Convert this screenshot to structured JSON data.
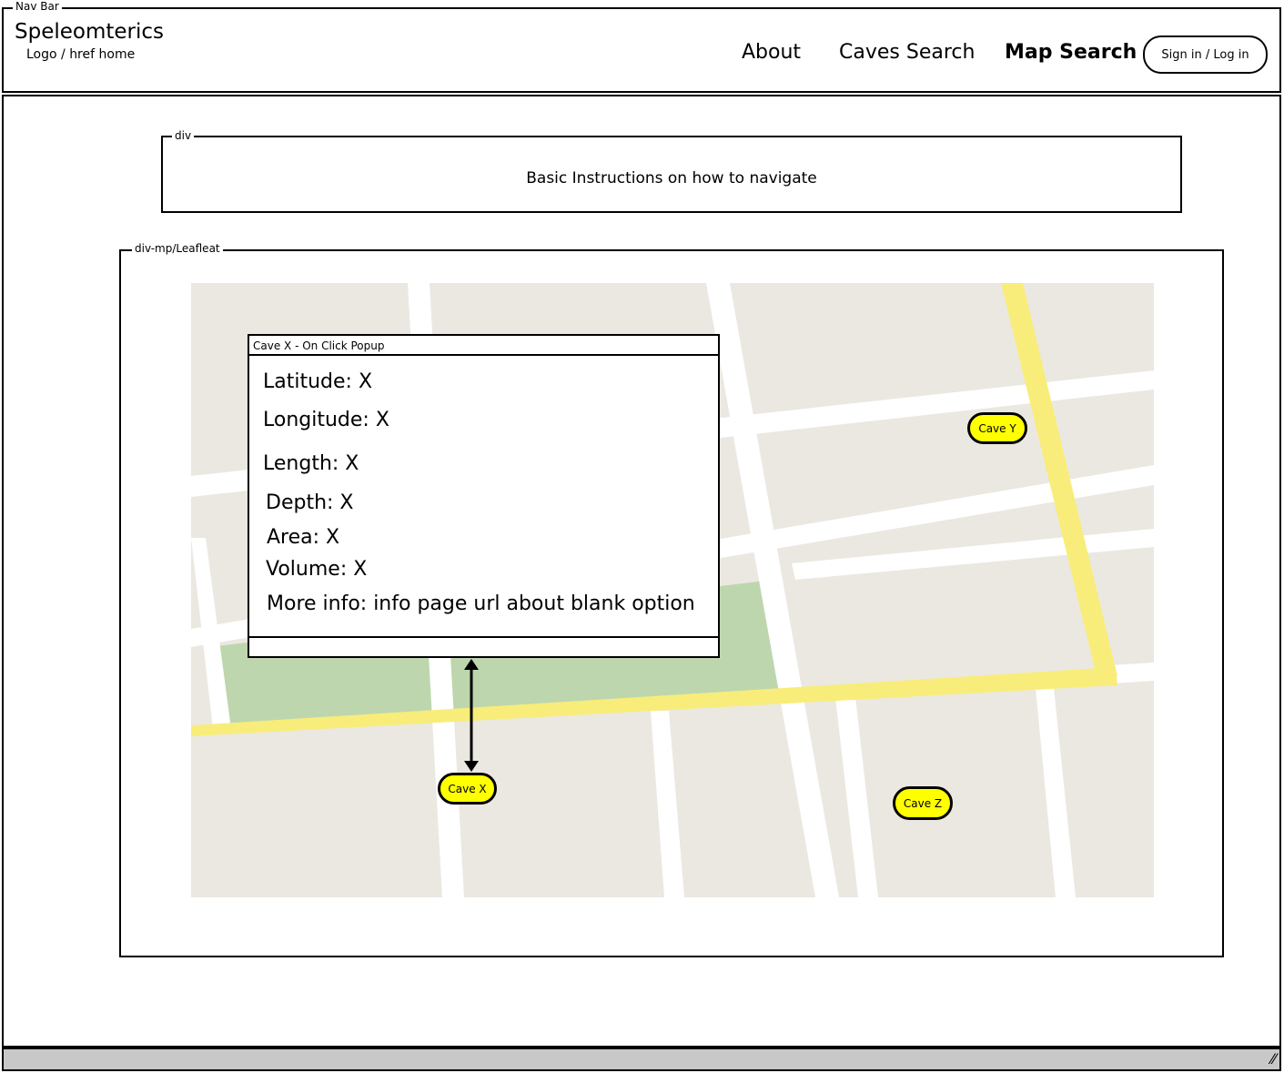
{
  "navbar": {
    "group_label": "Nav Bar",
    "brand": "Speleomterics",
    "brand_sub": "Logo / href home",
    "links": [
      {
        "label": "About"
      },
      {
        "label": "Caves Search"
      },
      {
        "label": "Map Search"
      }
    ],
    "signin_label": "Sign in / Log in"
  },
  "instructions": {
    "group_label": "div",
    "text": "Basic Instructions on how to navigate"
  },
  "map": {
    "group_label": "div-mp/Leafleat",
    "popup": {
      "title": "Cave X - On Click Popup",
      "lines": [
        "Latitude: X",
        "Longitude: X",
        "Length: X",
        "Depth: X",
        "Area: X",
        "Volume: X",
        "More info: info page url about blank option"
      ]
    },
    "markers": [
      {
        "label": "Cave X"
      },
      {
        "label": "Cave Y"
      },
      {
        "label": "Cave Z"
      }
    ],
    "colors": {
      "land": "#ebe8e1",
      "road": "#ffffff",
      "highway": "#f8ed7a",
      "park": "#bdd6ae",
      "marker": "#ffff00"
    }
  }
}
